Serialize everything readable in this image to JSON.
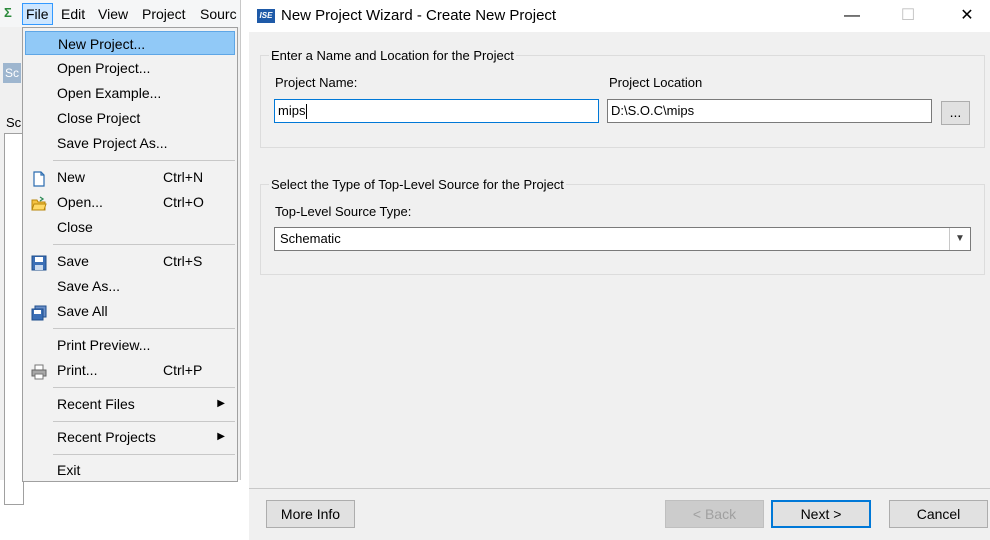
{
  "ide": {
    "menubar": [
      "File",
      "Edit",
      "View",
      "Project",
      "Sourc"
    ],
    "side_tab": "Sc",
    "side_text": "Sc"
  },
  "file_menu": {
    "items": [
      {
        "label": "New Project...",
        "shortcut": "",
        "icon": "",
        "highlight": true
      },
      {
        "label": "Open Project...",
        "shortcut": "",
        "icon": ""
      },
      {
        "label": "Open Example...",
        "shortcut": "",
        "icon": ""
      },
      {
        "label": "Close Project",
        "shortcut": "",
        "icon": ""
      },
      {
        "label": "Save Project As...",
        "shortcut": "",
        "icon": ""
      },
      {
        "label": "New",
        "shortcut": "Ctrl+N",
        "icon": "new-file-icon"
      },
      {
        "label": "Open...",
        "shortcut": "Ctrl+O",
        "icon": "open-folder-icon"
      },
      {
        "label": "Close",
        "shortcut": "",
        "icon": ""
      },
      {
        "label": "Save",
        "shortcut": "Ctrl+S",
        "icon": "save-disk-icon"
      },
      {
        "label": "Save As...",
        "shortcut": "",
        "icon": ""
      },
      {
        "label": "Save All",
        "shortcut": "",
        "icon": "save-all-icon"
      },
      {
        "label": "Print Preview...",
        "shortcut": "",
        "icon": ""
      },
      {
        "label": "Print...",
        "shortcut": "Ctrl+P",
        "icon": "printer-icon"
      },
      {
        "label": "Recent Files",
        "shortcut": "",
        "icon": "",
        "submenu": true
      },
      {
        "label": "Recent Projects",
        "shortcut": "",
        "icon": "",
        "submenu": true
      },
      {
        "label": "Exit",
        "shortcut": "",
        "icon": ""
      }
    ]
  },
  "dialog": {
    "app_icon_text": "ISE",
    "title": "New Project Wizard - Create New Project",
    "controls": {
      "minimize": "—",
      "maximize": "☐",
      "close": "✕"
    },
    "name_group": {
      "legend": "Enter a Name and Location for the Project",
      "name_label": "Project Name:",
      "name_value": "mips",
      "location_label": "Project Location",
      "location_value": "D:\\S.O.C\\mips",
      "browse_label": "..."
    },
    "type_group": {
      "legend": "Select the Type of Top-Level Source for the Project",
      "type_label": "Top-Level Source Type:",
      "type_value": "Schematic"
    },
    "buttons": {
      "more_info": "More Info",
      "back": "< Back",
      "next": "Next >",
      "cancel": "Cancel"
    }
  },
  "colors": {
    "menu_highlight": "#91c9f7",
    "focus_border": "#0078d7",
    "dialog_bg": "#f0f0f0"
  }
}
